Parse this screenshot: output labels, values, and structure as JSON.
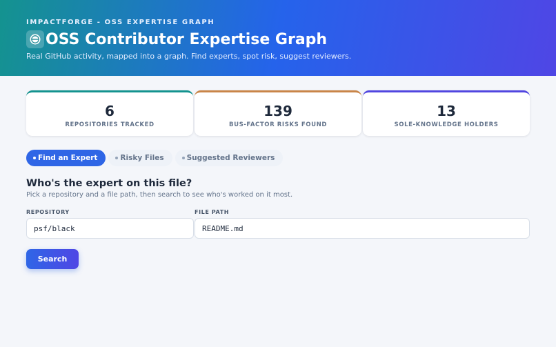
{
  "header": {
    "eyebrow": "IMPACTFORGE - OSS EXPERTISE GRAPH",
    "title": "OSS Contributor Expertise Graph",
    "subtitle": "Real GitHub activity, mapped into a graph. Find experts, spot risk, suggest reviewers.",
    "logo_icon": "globe-icon"
  },
  "stats": [
    {
      "value": "6",
      "label": "REPOSITORIES TRACKED",
      "accent": "#14938f"
    },
    {
      "value": "139",
      "label": "BUS-FACTOR RISKS FOUND",
      "accent": "#c98548"
    },
    {
      "value": "13",
      "label": "SOLE-KNOWLEDGE HOLDERS",
      "accent": "#5146e0"
    }
  ],
  "tabs": [
    {
      "label": "Find an Expert",
      "active": true
    },
    {
      "label": "Risky Files",
      "active": false
    },
    {
      "label": "Suggested Reviewers",
      "active": false
    }
  ],
  "finder": {
    "title": "Who's the expert on this file?",
    "description": "Pick a repository and a file path, then search to see who's worked on it most.",
    "repo_label": "REPOSITORY",
    "repo_value": "psf/black",
    "path_label": "FILE PATH",
    "path_value": "README.md",
    "search_label": "Search"
  },
  "colors": {
    "hero_start": "#14938f",
    "hero_mid": "#2563eb",
    "hero_end": "#4f46e5",
    "primary": "#2f66e6"
  }
}
